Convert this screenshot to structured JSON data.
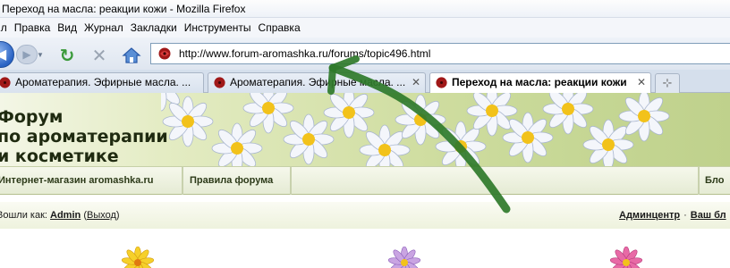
{
  "window": {
    "title": "Переход на масла: реакции кожи - Mozilla Firefox"
  },
  "menu": [
    "Файл",
    "Правка",
    "Вид",
    "Журнал",
    "Закладки",
    "Инструменты",
    "Справка"
  ],
  "menu_visible": [
    "йл",
    "Правка",
    "Вид",
    "Журнал",
    "Закладки",
    "Инструменты",
    "Справка"
  ],
  "toolbar": {
    "back_icon": "back-arrow-icon",
    "forward_icon": "forward-arrow-icon",
    "reload_icon": "reload-icon",
    "stop_icon": "stop-icon",
    "home_icon": "home-icon"
  },
  "address": {
    "url": "http://www.forum-aromashka.ru/forums/topic496.html"
  },
  "tabs": [
    {
      "label": "Ароматерапия. Эфирные масла. ...",
      "active": false
    },
    {
      "label": "Ароматерапия. Эфирные масла. ...",
      "active": false
    },
    {
      "label": "Переход на масла: реакции кожи",
      "active": true
    }
  ],
  "tab_close": "✕",
  "new_tab": "⊹",
  "site": {
    "banner_line1": "Форум",
    "banner_line2": "по ароматерапии",
    "banner_line3": "и косметике",
    "nav": [
      "Интернет-магазин aromashka.ru",
      "Правила форума",
      "Блог"
    ],
    "nav_visible": [
      "Интернет-магазин aromashka.ru",
      "Правила форума",
      "Бло"
    ]
  },
  "login": {
    "prefix": "Вошли как:",
    "user": "Admin",
    "paren_open": "(",
    "logout": "Выход",
    "paren_close": ")",
    "admin_link": "Админцентр",
    "sep": "·",
    "next_link": "Ваш бл"
  },
  "colors": {
    "arrow": "#2f7a2a",
    "banner_green": "#c6d795",
    "accent_blue": "#2a63c4"
  }
}
